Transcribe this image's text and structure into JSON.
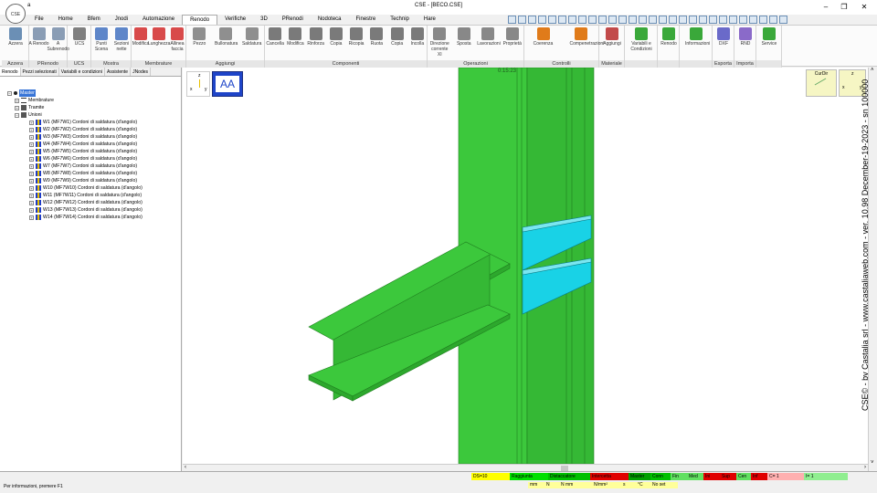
{
  "window": {
    "title": "CSE - [BECO.CSE]",
    "app_logo_text": "CSE",
    "qat_label": "a"
  },
  "menu": {
    "tabs": [
      "File",
      "Home",
      "Bfem",
      "Jnodi",
      "Automazione",
      "Renodo",
      "Verifiche",
      "3D",
      "PRenodi",
      "Nodoteca",
      "Finestre",
      "Technip",
      "Hare"
    ],
    "active": "Renodo"
  },
  "ribbon": {
    "groups": [
      {
        "label": "Azzera",
        "buttons": [
          "Azzera"
        ]
      },
      {
        "label": "PRenodo",
        "buttons": [
          "A Renodo",
          "A Subrenodo"
        ]
      },
      {
        "label": "UCS",
        "buttons": [
          "UCS"
        ]
      },
      {
        "label": "Mostra",
        "buttons": [
          "Punti Scena",
          "Sezioni nette"
        ]
      },
      {
        "label": "Membrature",
        "buttons": [
          "Modifica",
          "Lunghezza",
          "Allinea faccia"
        ]
      },
      {
        "label": "Aggiungi",
        "buttons": [
          "Pezzo",
          "Bullonatura",
          "Saldatura"
        ]
      },
      {
        "label": "Componenti",
        "buttons": [
          "Cancella",
          "Modifica",
          "Rinforza",
          "Copia",
          "Ricopia",
          "Ruota",
          "Copia",
          "Incolla"
        ]
      },
      {
        "label": "Operazioni",
        "buttons": [
          "Direzione corrente XI",
          "Sposta",
          "Lavorazioni",
          "Proprietà"
        ]
      },
      {
        "label": "Controlli",
        "buttons": [
          "Coerenza",
          "Compenetrazioni"
        ]
      },
      {
        "label": "Materiale",
        "buttons": [
          "Aggiungi"
        ]
      },
      {
        "label": "",
        "buttons": [
          "Variabili e Condizioni"
        ]
      },
      {
        "label": "",
        "buttons": [
          "Renodo"
        ]
      },
      {
        "label": "",
        "buttons": [
          "Informazioni"
        ]
      },
      {
        "label": "Esporta",
        "buttons": [
          "DXF"
        ]
      },
      {
        "label": "Importa",
        "buttons": [
          "RND"
        ]
      },
      {
        "label": "",
        "buttons": [
          "Service"
        ]
      }
    ]
  },
  "left_panel": {
    "tabs": [
      "Renodo",
      "Pezzi selezionati",
      "Variabili e condizioni",
      "Assistente",
      "JNodes"
    ],
    "active_tab": "Renodo",
    "tree": {
      "root": "Master",
      "membrature": "Membrature",
      "tramite": "Tramite",
      "unioni": "Unioni",
      "unioni_items": [
        "W1 (MF7W1)  Cordoni di saldatura (d'angolo)",
        "W2 (MF7W2)  Cordoni di saldatura (d'angolo)",
        "W3 (MF7W3)  Cordoni di saldatura (d'angolo)",
        "W4 (MF7W4)  Cordoni di saldatura (d'angolo)",
        "W5 (MF7W5)  Cordoni di saldatura (d'angolo)",
        "W6 (MF7W6)  Cordoni di saldatura (d'angolo)",
        "W7 (MF7W7)  Cordoni di saldatura (d'angolo)",
        "W8 (MF7W8)  Cordoni di saldatura (d'angolo)",
        "W9 (MF7W9)  Cordoni di saldatura (d'angolo)",
        "W10 (MF7W10)  Cordoni di saldatura (d'angolo)",
        "W11 (MF7W11)  Cordoni di saldatura (d'angolo)",
        "W12 (MF7W12)  Cordoni di saldatura (d'angolo)",
        "W13 (MF7W13)  Cordoni di saldatura (d'angolo)",
        "W14 (MF7W14)  Cordoni di saldatura (d'angolo)"
      ]
    }
  },
  "viewport": {
    "view_badge": "AA",
    "axis_z": "z",
    "axis_x": "x",
    "axis_y": "y",
    "time_label": "0:15:23",
    "curdir_label": "CurDir",
    "watermark": "CSE© - by Castalia srl - www.castaliaweb.com - ver. 10.98 December-19-2023 - sn 100000",
    "colors": {
      "member": "#3cc83c",
      "plate": "#19d2e6",
      "background": "#ffffff"
    }
  },
  "status": {
    "message": "Per informazioni, premere F1",
    "indicators": [
      {
        "label": "DS=10",
        "color": "#ffff00"
      },
      {
        "label": "Raggiunta",
        "color": "#00e000"
      },
      {
        "label": "Distaccatore",
        "color": "#00c000"
      },
      {
        "label": "Intercetta",
        "color": "#e00000"
      },
      {
        "label": "Master",
        "color": "#00a000"
      },
      {
        "label": "Conn",
        "color": "#00c000"
      },
      {
        "label": "Fin",
        "color": "#60e060"
      },
      {
        "label": "Med",
        "color": "#60e060"
      },
      {
        "label": "Ini",
        "color": "#e00000"
      },
      {
        "label": "Sup",
        "color": "#e00000"
      },
      {
        "label": "Cen",
        "color": "#60e060"
      },
      {
        "label": "Inf",
        "color": "#e00000"
      },
      {
        "label": "C= 1",
        "color": "#ffb0b0"
      },
      {
        "label": "I= 1",
        "color": "#90ee90"
      }
    ],
    "units": [
      "mm",
      "N",
      "N mm",
      "N/mm²",
      "s",
      "°C",
      "No set"
    ]
  }
}
